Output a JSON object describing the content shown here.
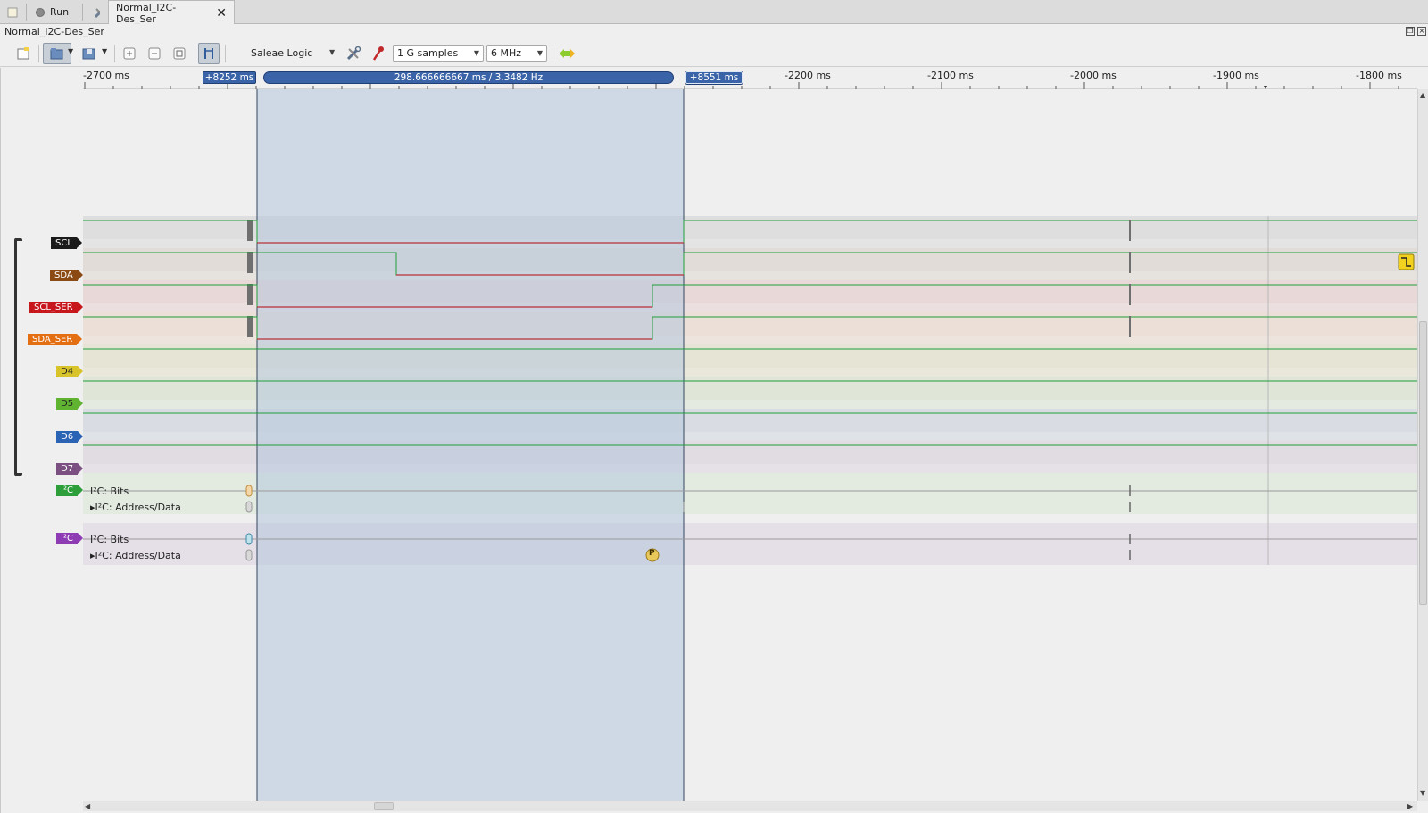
{
  "tabs": {
    "run_label": "Run",
    "session_label": "Normal_I2C-Des_Ser"
  },
  "window": {
    "title": "Normal_I2C-Des_Ser"
  },
  "toolbar": {
    "device": "Saleae Logic",
    "sample_count": "1 G samples",
    "sample_rate": "6 MHz"
  },
  "timeline": {
    "tick_labels": [
      "-2700 ms",
      "-2200 ms",
      "-2100 ms",
      "-2000 ms",
      "-1900 ms",
      "-1800 ms"
    ],
    "marker_left": "+8252 ms",
    "marker_measure": "298.666666667 ms / 3.3482 Hz",
    "marker_right": "+8551 ms"
  },
  "channels": [
    {
      "name": "SCL",
      "color": "#1a1a1a"
    },
    {
      "name": "SDA",
      "color": "#8b4a14"
    },
    {
      "name": "SCL_SER",
      "color": "#c8161d"
    },
    {
      "name": "SDA_SER",
      "color": "#e46e12"
    },
    {
      "name": "D4",
      "color": "#d8c42a"
    },
    {
      "name": "D5",
      "color": "#5fb331"
    },
    {
      "name": "D6",
      "color": "#2c64b5"
    },
    {
      "name": "D7",
      "color": "#7b4f82"
    }
  ],
  "analyzers": [
    {
      "tag": "I²C",
      "color": "#2e9e3a",
      "bits_label": "I²C: Bits",
      "data_label": "I²C: Address/Data"
    },
    {
      "tag": "I²C",
      "color": "#8e3cb3",
      "bits_label": "I²C: Bits",
      "data_label": "I²C: Address/Data"
    }
  ],
  "markers": {
    "stop_symbol": "P"
  }
}
